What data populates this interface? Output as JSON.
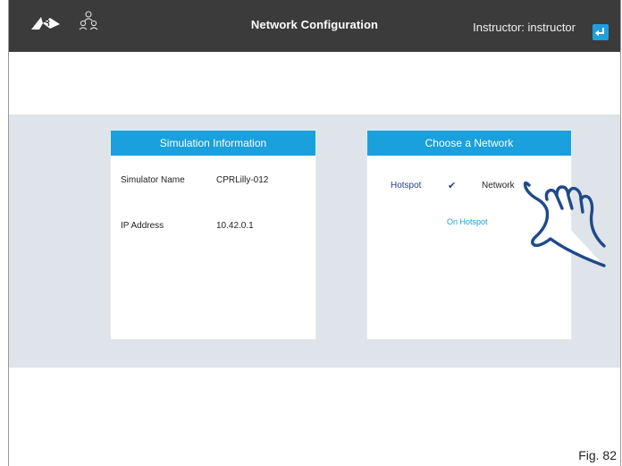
{
  "header": {
    "title": "Network Configuration",
    "user_label": "Instructor: instructor",
    "colors": {
      "bar": "#3b3b3b",
      "accent": "#1f9fe0"
    }
  },
  "simulation_card": {
    "title": "Simulation Information",
    "fields": [
      {
        "label": "Simulator Name",
        "value": "CPRLilly-012"
      },
      {
        "label": "IP Address",
        "value": "10.42.0.1"
      }
    ]
  },
  "network_card": {
    "title": "Choose a Network",
    "options": [
      {
        "label": "Hotspot",
        "selected": true
      },
      {
        "label": "Network",
        "selected": false
      }
    ],
    "check_mark": "✔",
    "status": "On Hotspot"
  },
  "figure_label": "Fig. 82"
}
